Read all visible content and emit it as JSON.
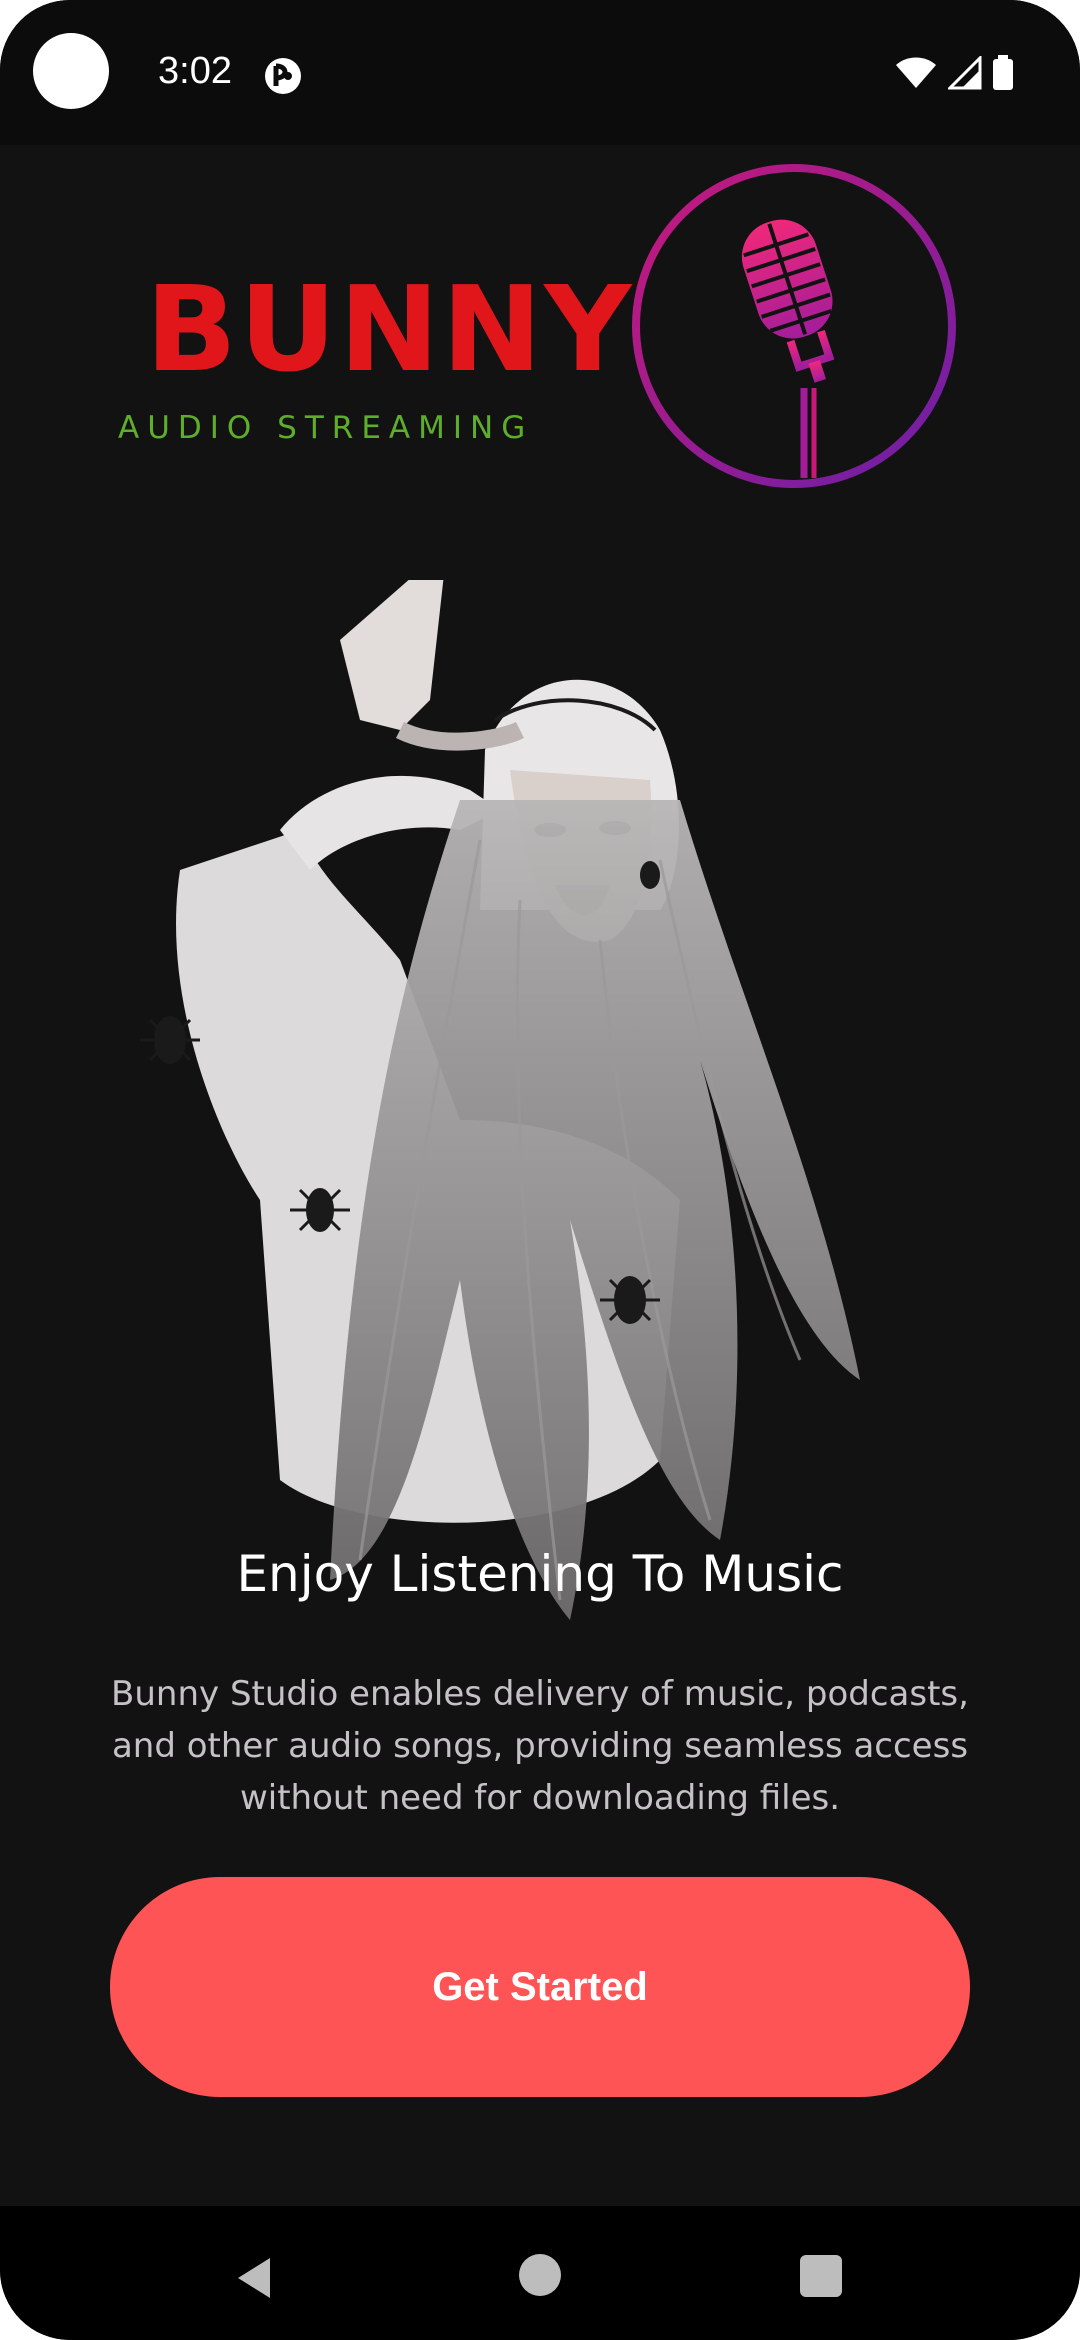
{
  "status_bar": {
    "time": "3:02",
    "icons": [
      "app-notification-icon",
      "wifi-icon",
      "cell-signal-icon",
      "battery-icon"
    ]
  },
  "logo": {
    "word": "BUNNY",
    "tagline": "AUDIO STREAMING",
    "emblem": "microphone-icon",
    "colors": {
      "word": "#e0161b",
      "tagline": "#5fae2b",
      "ring_start": "#c8197a",
      "ring_end": "#6a1fa8",
      "mic": "#e5277e"
    }
  },
  "onboarding": {
    "illustration": "girl-illustration",
    "title": "Enjoy Listening To Music",
    "description": "Bunny Studio enables delivery of music, podcasts, and other audio songs, providing seamless access without need for downloading files.",
    "cta_label": "Get Started",
    "cta_color": "#ff5456"
  },
  "nav_bar": {
    "icons": [
      "back-icon",
      "home-icon",
      "recents-icon"
    ]
  }
}
